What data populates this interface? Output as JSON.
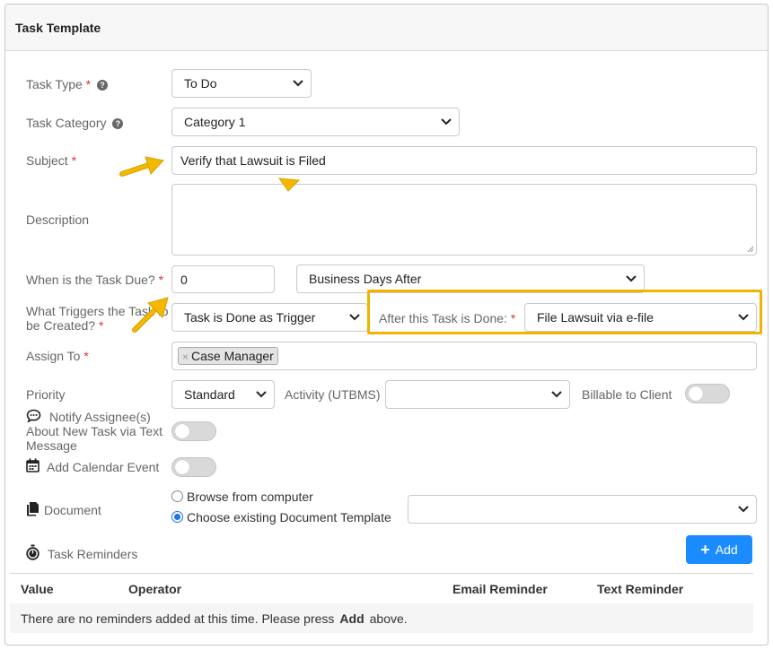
{
  "panel": {
    "title": "Task Template"
  },
  "form": {
    "required_mark": "*",
    "task_type": {
      "label": "Task Type",
      "value": "To Do"
    },
    "task_category": {
      "label": "Task Category",
      "value": "Category 1"
    },
    "subject": {
      "label": "Subject",
      "value": "Verify that Lawsuit is Filed"
    },
    "description": {
      "label": "Description",
      "value": ""
    },
    "due": {
      "label": "When is the Task Due?",
      "days": "0",
      "mode": "Business Days After"
    },
    "trigger": {
      "label_line1": "What Triggers the Task to",
      "label_line2": "be Created?",
      "value": "Task is Done as Trigger"
    },
    "after_task": {
      "label": "After this Task is Done:",
      "value": "File Lawsuit via e-file"
    },
    "assign_to": {
      "label": "Assign To",
      "tag": "Case Manager",
      "tag_remove": "×"
    },
    "priority": {
      "label": "Priority",
      "value": "Standard"
    },
    "activity": {
      "label": "Activity (UTBMS)",
      "value": ""
    },
    "billable": {
      "label": "Billable to Client",
      "on": false
    },
    "notify": {
      "label_line1": "Notify Assignee(s)",
      "label_line2": "About New Task via Text",
      "label_line3": "Message",
      "on": false
    },
    "calendar": {
      "label": "Add Calendar Event",
      "on": false
    },
    "document": {
      "label": "Document",
      "option_browse": "Browse from computer",
      "option_template": "Choose existing Document Template",
      "selected": "template",
      "template_value": ""
    },
    "help_glyph": "?"
  },
  "reminders": {
    "label": "Task Reminders",
    "add_button": "Add",
    "columns": [
      "Value",
      "Operator",
      "Email Reminder",
      "Text Reminder"
    ],
    "empty_prefix": "There are no reminders added at this time. Please press",
    "empty_bold": "Add",
    "empty_suffix": "above."
  },
  "colors": {
    "accent": "#1a8cff",
    "highlight": "#f0b400",
    "required": "#d33333"
  },
  "icons": [
    "help-icon",
    "chevron-down-icon",
    "chat-bubble-icon",
    "calendar-icon",
    "document-icon",
    "stopwatch-icon",
    "plus-icon",
    "annotation-arrow-icon"
  ]
}
